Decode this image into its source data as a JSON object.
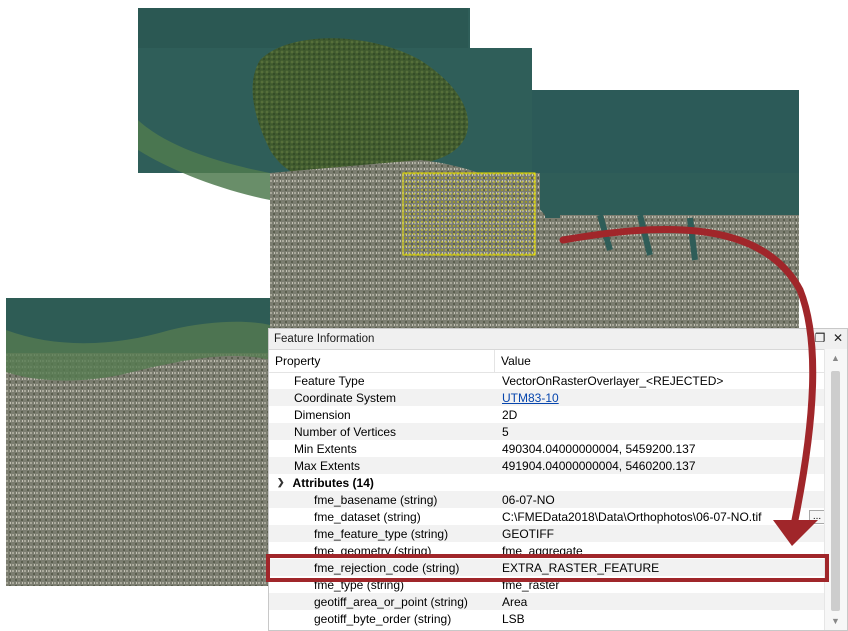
{
  "panel": {
    "title": "Feature Information",
    "restore_icon": "❐",
    "close_icon": "✕"
  },
  "columns": {
    "property": "Property",
    "value": "Value"
  },
  "properties": [
    {
      "name": "Feature Type",
      "value": "VectorOnRasterOverlayer_<REJECTED>"
    },
    {
      "name": "Coordinate System",
      "value": "UTM83-10",
      "link": true
    },
    {
      "name": "Dimension",
      "value": "2D"
    },
    {
      "name": "Number of Vertices",
      "value": "5"
    },
    {
      "name": "Min Extents",
      "value": "490304.04000000004, 5459200.137"
    },
    {
      "name": "Max Extents",
      "value": "491904.04000000004, 5460200.137"
    }
  ],
  "attributes_group": {
    "label": "Attributes (14)"
  },
  "attributes": [
    {
      "name": "fme_basename (string)",
      "value": "06-07-NO"
    },
    {
      "name": "fme_dataset (string)",
      "value": "C:\\FMEData2018\\Data\\Orthophotos\\06-07-NO.tif",
      "ellipsis": "..."
    },
    {
      "name": "fme_feature_type (string)",
      "value": "GEOTIFF"
    },
    {
      "name": "fme_geometry (string)",
      "value": "fme_aggregate"
    },
    {
      "name": "fme_rejection_code (string)",
      "value": "EXTRA_RASTER_FEATURE"
    },
    {
      "name": "fme_type (string)",
      "value": "fme_raster"
    },
    {
      "name": "geotiff_area_or_point (string)",
      "value": "Area"
    },
    {
      "name": "geotiff_byte_order (string)",
      "value": "LSB"
    }
  ],
  "colors": {
    "highlight": "#a0262a",
    "selection_box": "#e8e000",
    "water": "#2f5e59",
    "land": "#6f7a5a"
  }
}
